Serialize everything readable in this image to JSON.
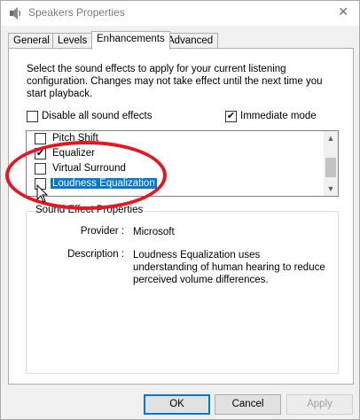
{
  "window": {
    "title": "Speakers Properties",
    "close_glyph": "✕"
  },
  "tabs": [
    {
      "label": "General",
      "active": false
    },
    {
      "label": "Levels",
      "active": false
    },
    {
      "label": "Enhancements",
      "active": true
    },
    {
      "label": "Advanced",
      "active": false
    }
  ],
  "enhancements": {
    "description": "Select the sound effects to apply for your current listening configuration. Changes may not take effect until the next time you start playback.",
    "disable_all": {
      "label": "Disable all sound effects",
      "checked": false
    },
    "immediate_mode": {
      "label": "Immediate mode",
      "checked": true
    },
    "effects": [
      {
        "label": "Pitch Shift",
        "checked": false,
        "selected": false
      },
      {
        "label": "Equalizer",
        "checked": true,
        "selected": false
      },
      {
        "label": "Virtual Surround",
        "checked": false,
        "selected": false
      },
      {
        "label": "Loudness Equalization",
        "checked": false,
        "selected": true
      }
    ],
    "scroll_up_glyph": "▲",
    "scroll_down_glyph": "▼"
  },
  "properties": {
    "group_title": "Sound Effect Properties",
    "provider_label": "Provider :",
    "provider_value": "Microsoft",
    "description_label": "Description :",
    "description_value": "Loudness Equalization uses understanding of human hearing to reduce perceived volume differences."
  },
  "buttons": {
    "ok": "OK",
    "cancel": "Cancel",
    "apply": "Apply"
  },
  "check_glyph": "✔",
  "colors": {
    "selection": "#0078d7",
    "annotation": "#e8141f"
  },
  "icons": {
    "title": "speaker-icon",
    "close": "close-icon",
    "cursor": "mouse-cursor-icon"
  }
}
